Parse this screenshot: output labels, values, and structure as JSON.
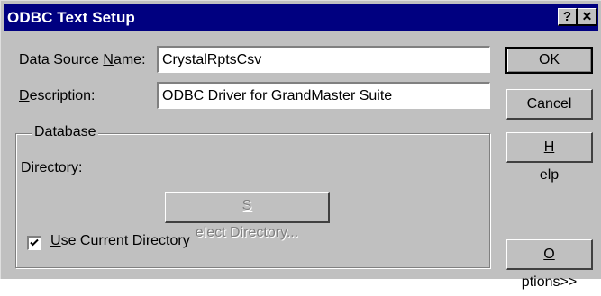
{
  "window": {
    "title": "ODBC Text Setup",
    "help_button": "?",
    "close_button": "✕"
  },
  "form": {
    "data_source_name_label_pre": "Data Source ",
    "data_source_name_label_ul": "N",
    "data_source_name_label_post": "ame:",
    "data_source_name_value": "CrystalRptsCsv",
    "description_label_ul": "D",
    "description_label_post": "escription:",
    "description_value": "ODBC Driver for GrandMaster Suite"
  },
  "database_group": {
    "title": "Database",
    "directory_label": "Directory:",
    "select_directory_ul": "S",
    "select_directory_post": "elect Directory...",
    "use_current_checked": true,
    "use_current_ul": "U",
    "use_current_post": "se Current Directory"
  },
  "buttons": {
    "ok": "OK",
    "cancel": "Cancel",
    "help_ul": "H",
    "help_post": "elp",
    "options_ul": "O",
    "options_post": "ptions>>"
  }
}
